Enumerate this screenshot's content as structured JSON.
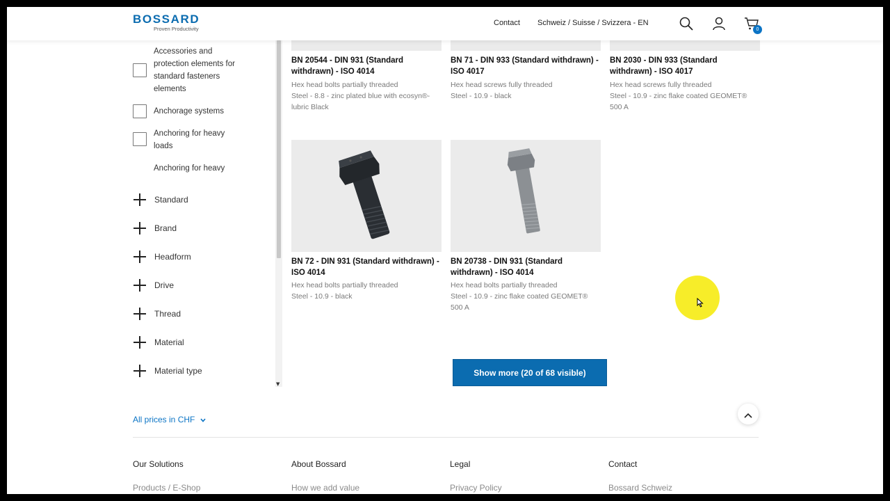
{
  "header": {
    "logo_text": "BOSSARD",
    "logo_tagline": "Proven Productivity",
    "contact_label": "Contact",
    "region_label": "Schweiz / Suisse / Svizzera - EN",
    "cart_count": "0",
    "brand_color": "#0b6cb0"
  },
  "sidebar": {
    "checkbox_items": [
      {
        "label": "Accessories and protection elements for standard fasteners elements"
      },
      {
        "label": "Anchorage systems"
      },
      {
        "label": "Anchoring for heavy loads"
      },
      {
        "label": "Anchoring for heavy"
      }
    ],
    "facets": [
      {
        "label": "Standard"
      },
      {
        "label": "Brand"
      },
      {
        "label": "Headform"
      },
      {
        "label": "Drive"
      },
      {
        "label": "Thread"
      },
      {
        "label": "Material"
      },
      {
        "label": "Material type"
      }
    ]
  },
  "products": [
    {
      "title": "BN 20544 - DIN 931 (Standard withdrawn) - ISO 4014",
      "type": "Hex head bolts partially threaded",
      "spec": "Steel - 8.8 - zinc plated blue with ecosyn®-lubric Black"
    },
    {
      "title": "BN 71 - DIN 933 (Standard withdrawn) - ISO 4017",
      "type": "Hex head screws fully threaded",
      "spec": "Steel - 10.9 - black"
    },
    {
      "title": "BN 2030 - DIN 933 (Standard withdrawn) - ISO 4017",
      "type": "Hex head screws fully threaded",
      "spec": "Steel - 10.9 - zinc flake coated GEOMET® 500 A"
    },
    {
      "title": "BN 72 - DIN 931 (Standard withdrawn) - ISO 4014",
      "type": "Hex head bolts partially threaded",
      "spec": "Steel - 10.9 - black"
    },
    {
      "title": "BN 20738 - DIN 931 (Standard withdrawn) - ISO 4014",
      "type": "Hex head bolts partially threaded",
      "spec": "Steel - 10.9 - zinc flake coated GEOMET® 500 A"
    }
  ],
  "show_more_label": "Show more (20 of 68 visible)",
  "prices_label": "All prices in CHF",
  "footer": {
    "columns": [
      {
        "heading": "Our Solutions",
        "link": "Products / E-Shop"
      },
      {
        "heading": "About Bossard",
        "link": "How we add value"
      },
      {
        "heading": "Legal",
        "link": "Privacy Policy"
      },
      {
        "heading": "Contact",
        "link": "Bossard Schweiz"
      }
    ]
  }
}
